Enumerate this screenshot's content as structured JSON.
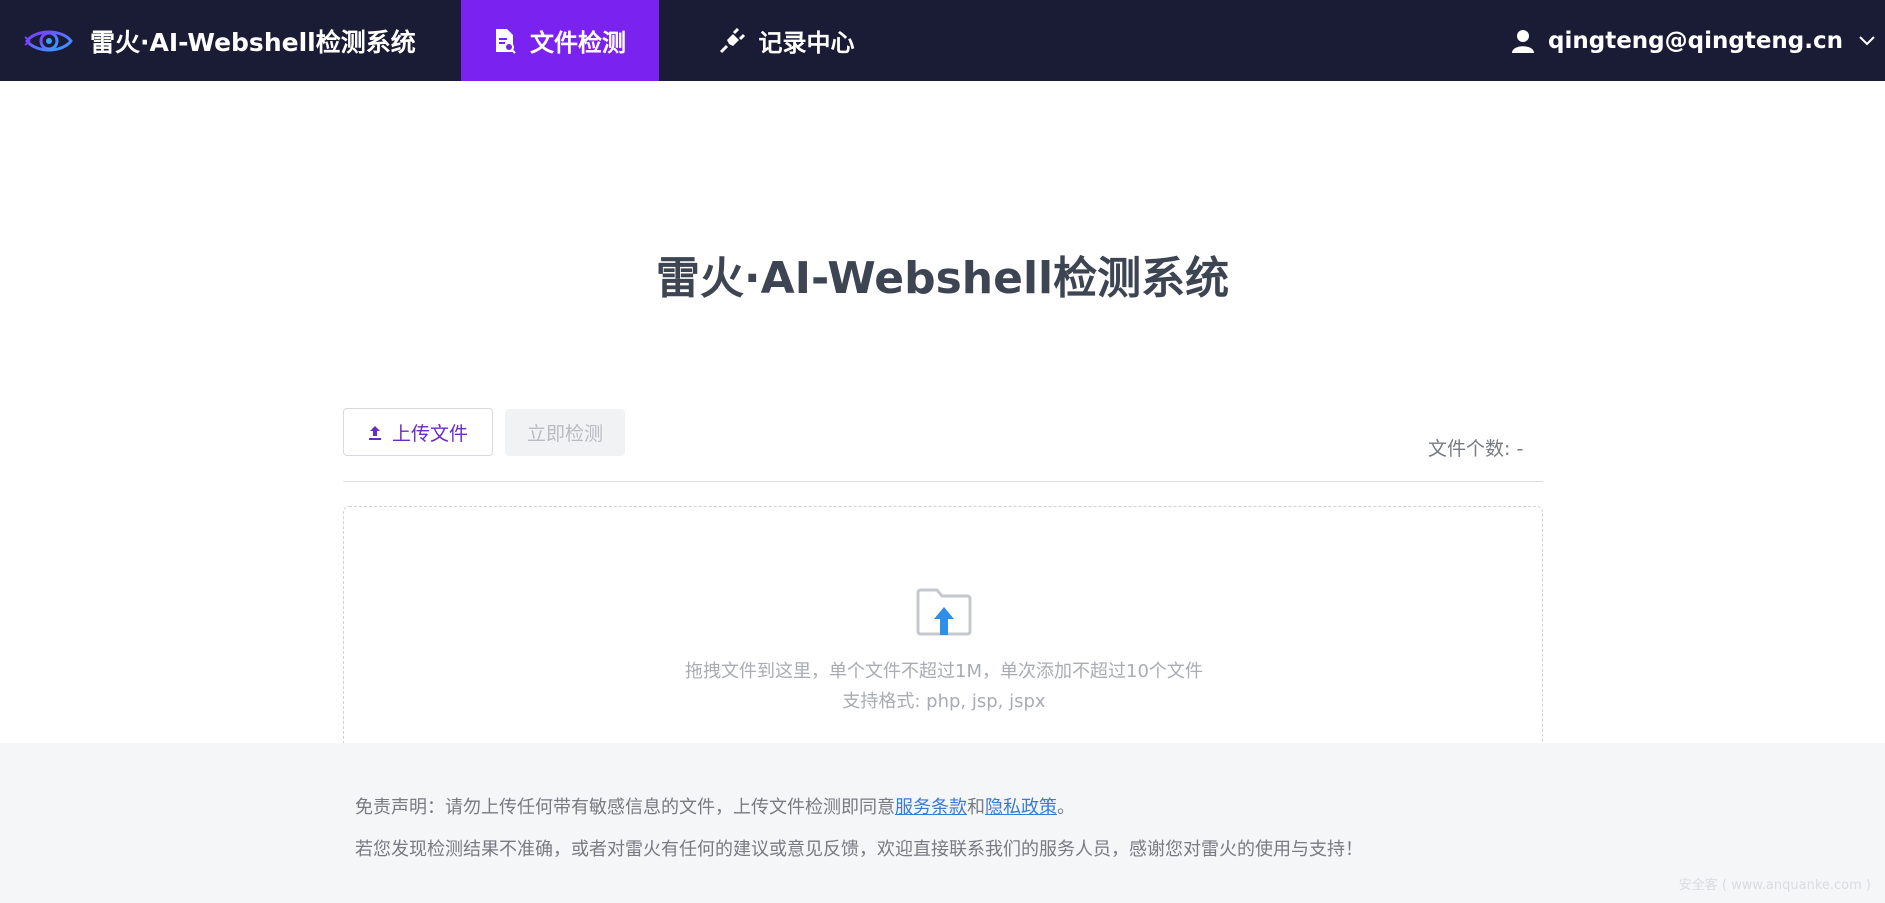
{
  "header": {
    "app_title": "雷火·AI-Webshell检测系统",
    "tabs": [
      {
        "label": "文件检测",
        "icon": "file-search-icon",
        "active": true
      },
      {
        "label": "记录中心",
        "icon": "plug-icon",
        "active": false
      }
    ],
    "user": {
      "email": "qingteng@qingteng.cn",
      "icon": "user-icon"
    }
  },
  "main": {
    "title": "雷火·AI-Webshell检测系统",
    "toolbar": {
      "upload_label": "上传文件",
      "detect_label": "立即检测",
      "file_count_label": "文件个数:",
      "file_count_value": "-"
    },
    "dropzone": {
      "line1": "拖拽文件到这里，单个文件不超过1M，单次添加不超过10个文件",
      "line2": "支持格式: php, jsp, jspx"
    }
  },
  "footer": {
    "disclaimer_prefix": "免责声明：请勿上传任何带有敏感信息的文件，上传文件检测即同意",
    "terms_link": "服务条款",
    "and": "和",
    "privacy_link": "隐私政策",
    "period": "。",
    "feedback": "若您发现检测结果不准确，或者对雷火有任何的建议或意见反馈，欢迎直接联系我们的服务人员，感谢您对雷火的使用与支持！",
    "watermark": "安全客 ( www.anquanke.com )"
  },
  "colors": {
    "topbar_bg": "#1a1c36",
    "active_tab": "#7a22f0",
    "link": "#3b7bd6",
    "footer_bg": "#f5f6f8"
  }
}
